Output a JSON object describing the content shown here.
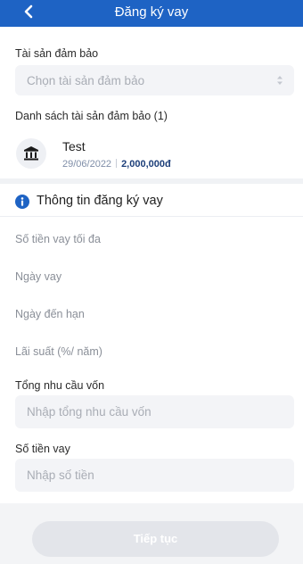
{
  "header": {
    "title": "Đăng ký vay",
    "back_icon": "chevron-left-icon",
    "background_color": "#1e63c4"
  },
  "collateral": {
    "label": "Tài sản đảm bảo",
    "select_placeholder": "Chọn tài sản đảm bảo",
    "caret_icon": "sort-caret-icon"
  },
  "asset_list": {
    "title": "Danh sách tài sản đảm bảo (1)",
    "items": [
      {
        "icon": "bank-icon",
        "name": "Test",
        "date": "29/06/2022",
        "amount": "2,000,000đ"
      }
    ]
  },
  "loan_info": {
    "icon": "info-icon",
    "title": "Thông tin đăng ký vay",
    "fields": {
      "max_amount_label": "Số tiền vay tối đa",
      "loan_date_label": "Ngày vay",
      "due_date_label": "Ngày đến hạn",
      "interest_rate_label": "Lãi suất (%/ năm)"
    },
    "capital_need": {
      "label": "Tổng nhu cầu vốn",
      "placeholder": "Nhập tổng nhu cầu vốn",
      "value": ""
    },
    "loan_amount": {
      "label": "Số tiền vay",
      "placeholder": "Nhập số tiền",
      "value": ""
    }
  },
  "footer": {
    "continue_label": "Tiếp tục"
  }
}
